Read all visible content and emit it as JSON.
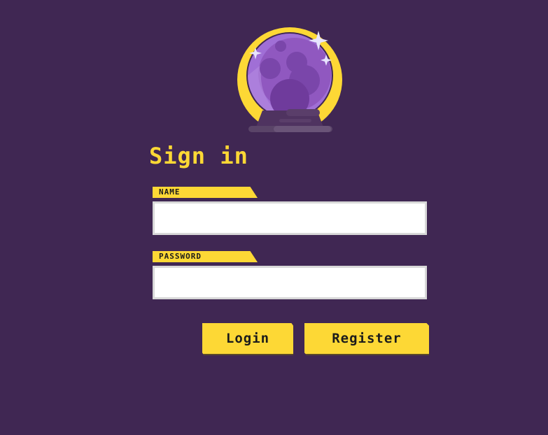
{
  "app": {
    "title": "Sign in"
  },
  "form": {
    "name_label": "NAME",
    "name_value": "",
    "password_label": "PASSWORD",
    "password_value": ""
  },
  "buttons": {
    "login_label": "Login",
    "register_label": "Register"
  },
  "logo": {
    "icon": "crystal-ball-icon"
  },
  "colors": {
    "background": "#402753",
    "accent": "#fdd835",
    "orb": "#9b5fc0"
  }
}
